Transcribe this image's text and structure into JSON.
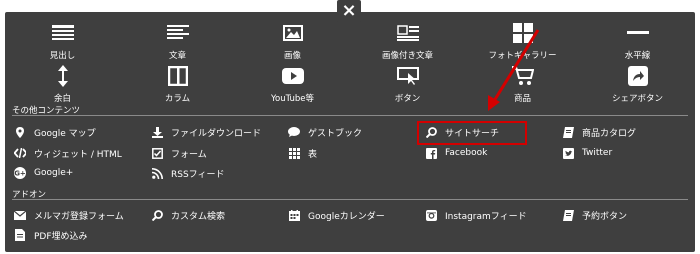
{
  "close_label": "×",
  "top_row": [
    {
      "label": "見出し",
      "icon": "heading-icon"
    },
    {
      "label": "文章",
      "icon": "text-icon"
    },
    {
      "label": "画像",
      "icon": "image-icon"
    },
    {
      "label": "画像付き文章",
      "icon": "image-text-icon"
    },
    {
      "label": "フォトギャラリー",
      "icon": "gallery-icon"
    },
    {
      "label": "水平線",
      "icon": "hr-icon"
    }
  ],
  "second_row": [
    {
      "label": "余白",
      "icon": "spacing-icon"
    },
    {
      "label": "カラム",
      "icon": "column-icon"
    },
    {
      "label": "YouTube等",
      "icon": "youtube-icon"
    },
    {
      "label": "ボタン",
      "icon": "button-icon"
    },
    {
      "label": "商品",
      "icon": "cart-icon"
    },
    {
      "label": "シェアボタン",
      "icon": "share-icon"
    }
  ],
  "other_contents": {
    "title": "その他コンテンツ",
    "items": [
      {
        "label": "Google マップ",
        "icon": "map-pin-icon"
      },
      {
        "label": "ファイルダウンロード",
        "icon": "download-icon"
      },
      {
        "label": "ゲストブック",
        "icon": "comment-icon"
      },
      {
        "label": "サイトサーチ",
        "icon": "search-icon"
      },
      {
        "label": "商品カタログ",
        "icon": "book-icon"
      },
      {
        "label": "ウィジェット / HTML",
        "icon": "code-icon"
      },
      {
        "label": "フォーム",
        "icon": "checkbox-icon"
      },
      {
        "label": "表",
        "icon": "table-icon"
      },
      {
        "label": "Facebook",
        "icon": "facebook-icon"
      },
      {
        "label": "Twitter",
        "icon": "twitter-icon"
      },
      {
        "label": "Google+",
        "icon": "google-plus-icon"
      },
      {
        "label": "RSSフィード",
        "icon": "rss-icon"
      }
    ]
  },
  "addons": {
    "title": "アドオン",
    "items": [
      {
        "label": "メルマガ登録フォーム",
        "icon": "mail-icon"
      },
      {
        "label": "カスタム検索",
        "icon": "search-icon"
      },
      {
        "label": "Googleカレンダー",
        "icon": "calendar-icon"
      },
      {
        "label": "Instagramフィード",
        "icon": "instagram-icon"
      },
      {
        "label": "予約ボタン",
        "icon": "book-icon"
      },
      {
        "label": "PDF埋め込み",
        "icon": "pdf-icon"
      }
    ]
  },
  "colors": {
    "panel": "#3f3f3f",
    "highlight": "#d40000",
    "text": "#ffffff"
  }
}
